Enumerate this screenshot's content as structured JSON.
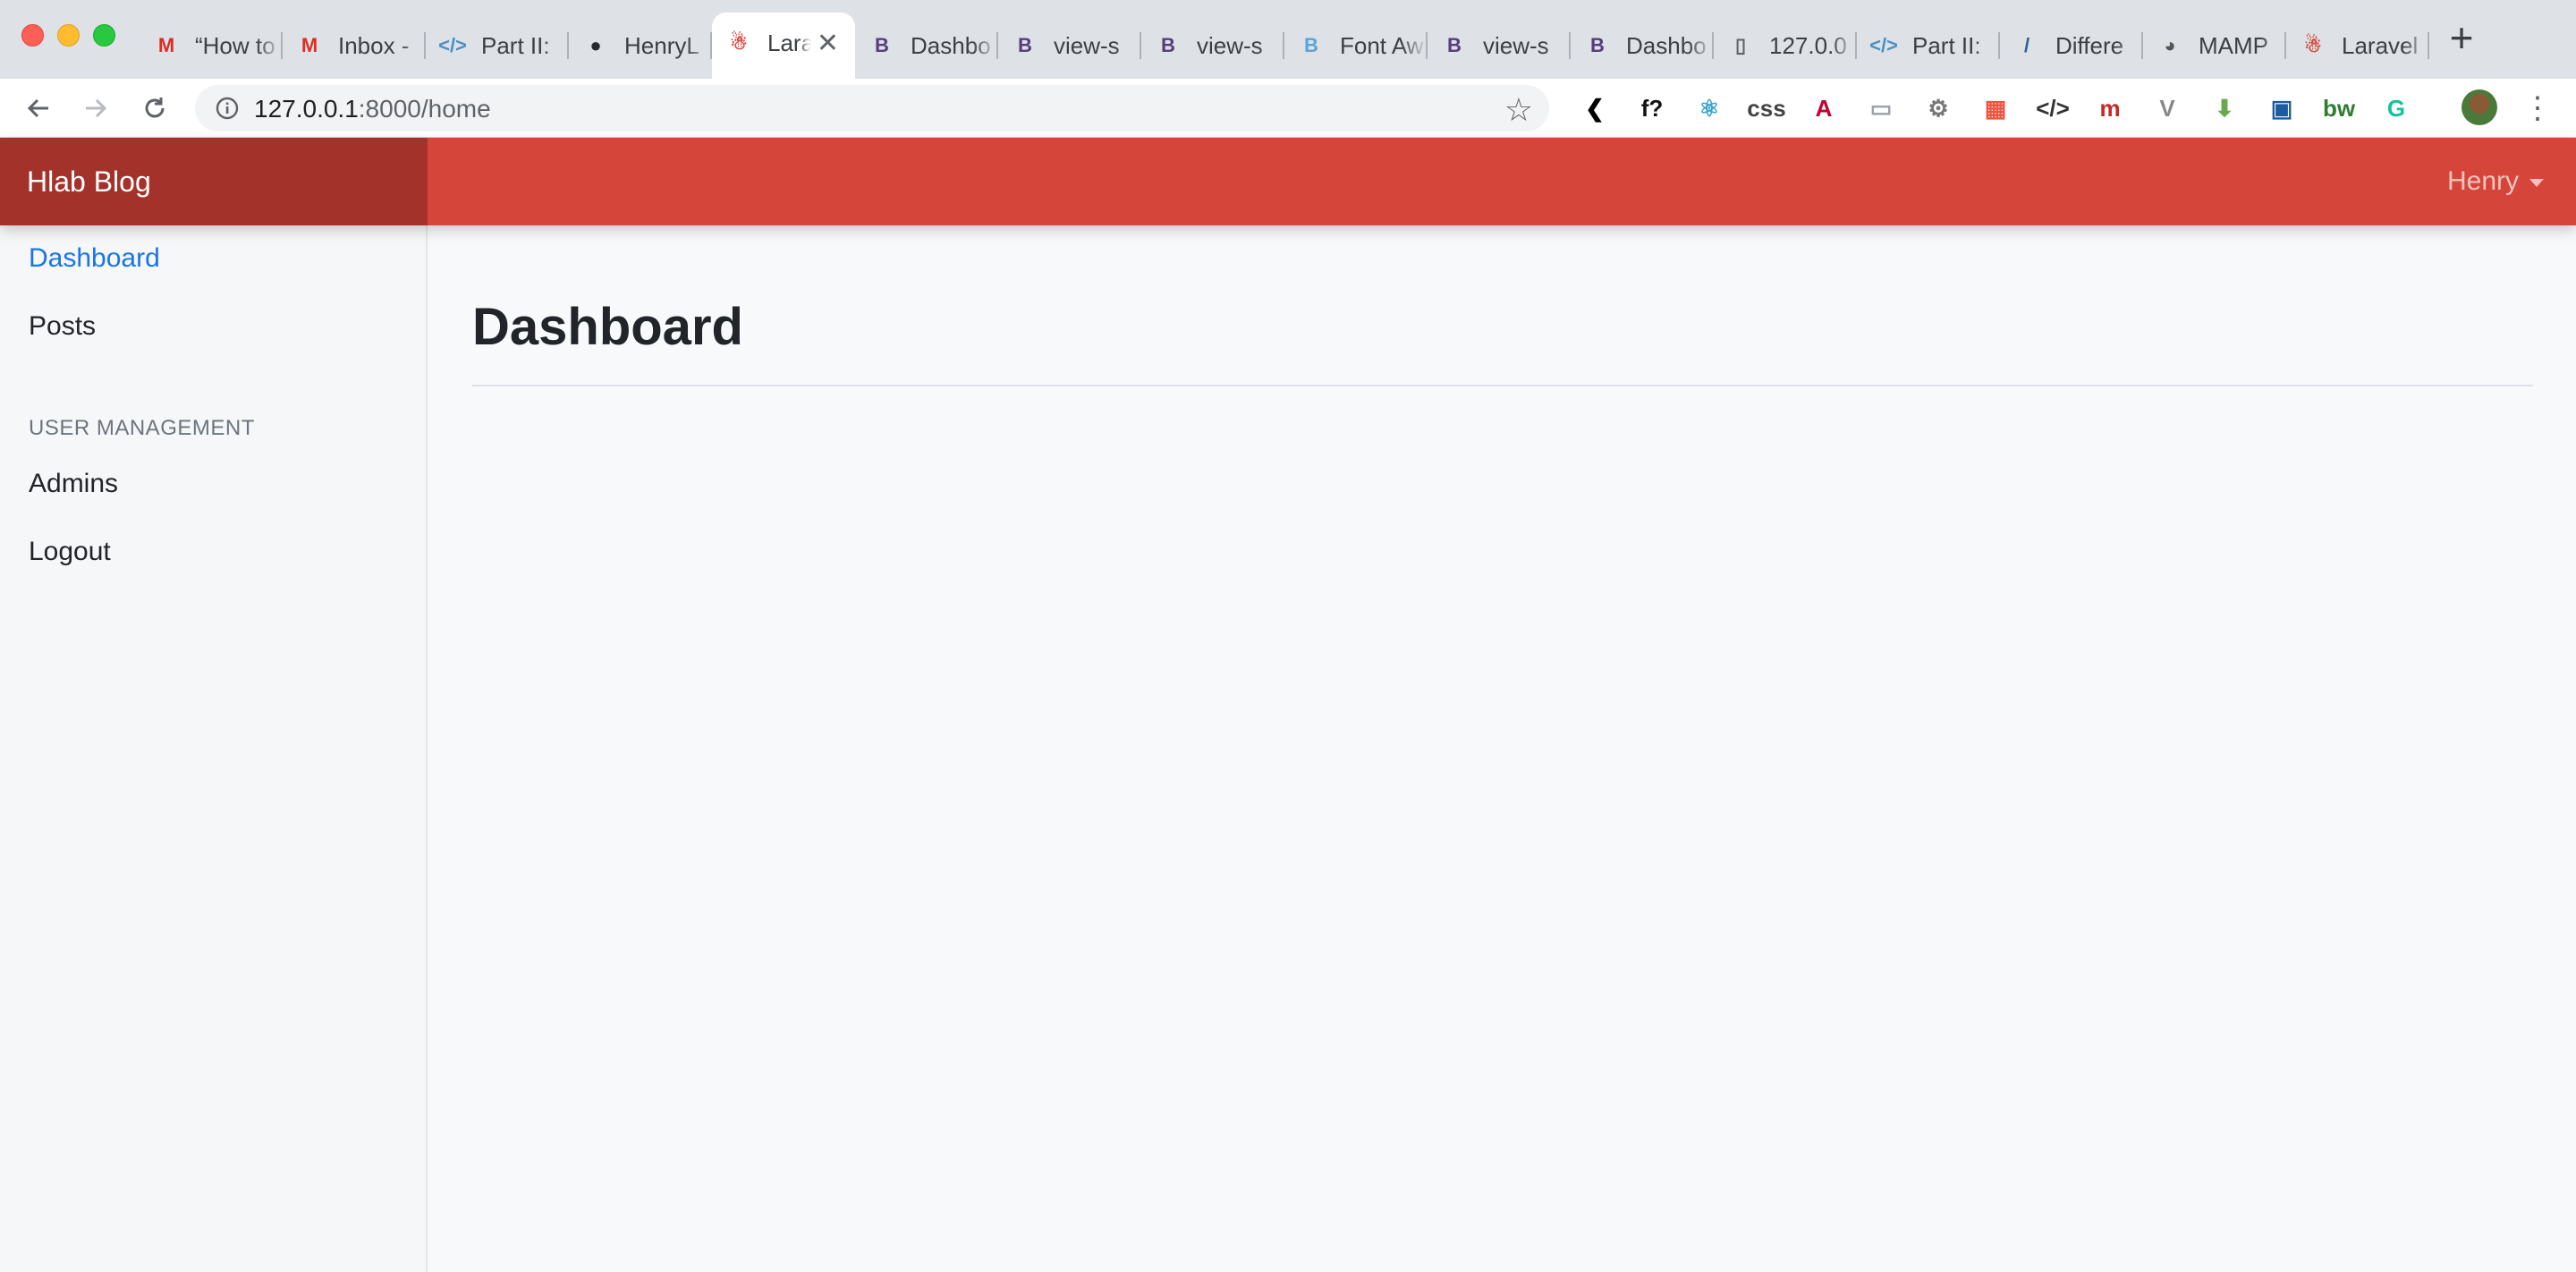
{
  "browser": {
    "tabs": [
      {
        "label": "“How to",
        "icon": "gmail-icon",
        "color": "#d93025",
        "glyph": "M"
      },
      {
        "label": "Inbox -",
        "icon": "gmail-icon",
        "color": "#d93025",
        "glyph": "M"
      },
      {
        "label": "Part II:",
        "icon": "code-icon",
        "color": "#4a90c2",
        "glyph": "</>"
      },
      {
        "label": "HenryL",
        "icon": "github-icon",
        "color": "#24292e",
        "glyph": "●"
      },
      {
        "label": "Lara",
        "icon": "laravel-icon",
        "color": "#d5453a",
        "glyph": "☃",
        "active": true
      },
      {
        "label": "Dashbo",
        "icon": "bootstrap-icon",
        "color": "#563d7c",
        "glyph": "B"
      },
      {
        "label": "view-s",
        "icon": "bootstrap-icon",
        "color": "#563d7c",
        "glyph": "B"
      },
      {
        "label": "view-s",
        "icon": "bootstrap-icon",
        "color": "#563d7c",
        "glyph": "B"
      },
      {
        "label": "Font Aw",
        "icon": "bootstrap-icon",
        "color": "#5aa4d8",
        "glyph": "B"
      },
      {
        "label": "view-s",
        "icon": "bootstrap-icon",
        "color": "#563d7c",
        "glyph": "B"
      },
      {
        "label": "Dashbo",
        "icon": "bootstrap-icon",
        "color": "#563d7c",
        "glyph": "B"
      },
      {
        "label": "127.0.0",
        "icon": "page-icon",
        "color": "#5f6368",
        "glyph": "▯"
      },
      {
        "label": "Part II:",
        "icon": "code-icon",
        "color": "#4a90c2",
        "glyph": "</>"
      },
      {
        "label": "Differe",
        "icon": "stripe-icon",
        "color": "#2f5f8f",
        "glyph": "/"
      },
      {
        "label": "MAMP",
        "icon": "mamp-icon",
        "color": "#555555",
        "glyph": "◕"
      },
      {
        "label": "Laravel",
        "icon": "laravel-icon",
        "color": "#d5453a",
        "glyph": "☃"
      }
    ],
    "url_host": "127.0.0.1",
    "url_rest": ":8000/home",
    "extensions": [
      {
        "name": "back-chevron-ext-icon",
        "glyph": "❮",
        "color": "#000000"
      },
      {
        "name": "function-ext-icon",
        "glyph": "f?",
        "color": "#111111"
      },
      {
        "name": "atom-ext-icon",
        "glyph": "⚛",
        "color": "#3aa3c8"
      },
      {
        "name": "css-ext-icon",
        "glyph": "css",
        "color": "#444444"
      },
      {
        "name": "angular-ext-icon",
        "glyph": "A",
        "color": "#c3002f"
      },
      {
        "name": "window-ext-icon",
        "glyph": "▭",
        "color": "#9aa0a6"
      },
      {
        "name": "gear-ext-icon",
        "glyph": "⚙",
        "color": "#777777"
      },
      {
        "name": "laravel-ext-icon",
        "glyph": "▦",
        "color": "#f05340"
      },
      {
        "name": "code-ext-icon",
        "glyph": "</>",
        "color": "#333333"
      },
      {
        "name": "m-ext-icon",
        "glyph": "m",
        "color": "#c62828"
      },
      {
        "name": "vue-ext-icon",
        "glyph": "V",
        "color": "#888888"
      },
      {
        "name": "download-ext-icon",
        "glyph": "⬇",
        "color": "#6aa84f"
      },
      {
        "name": "toolbox-ext-icon",
        "glyph": "▣",
        "color": "#1e5a9e"
      },
      {
        "name": "bw-ext-icon",
        "glyph": "bw",
        "color": "#2e7d32"
      },
      {
        "name": "grammarly-ext-icon",
        "glyph": "G",
        "color": "#15c39a"
      }
    ]
  },
  "app": {
    "brand": "Hlab Blog",
    "user": "Henry",
    "nav": {
      "dashboard": "Dashboard",
      "posts": "Posts",
      "heading": "USER MANAGEMENT",
      "admins": "Admins",
      "logout": "Logout"
    },
    "page_title": "Dashboard",
    "colors": {
      "accent": "#d5453a",
      "brand_dark": "#a3322b",
      "link_active": "#1a73e8"
    }
  }
}
